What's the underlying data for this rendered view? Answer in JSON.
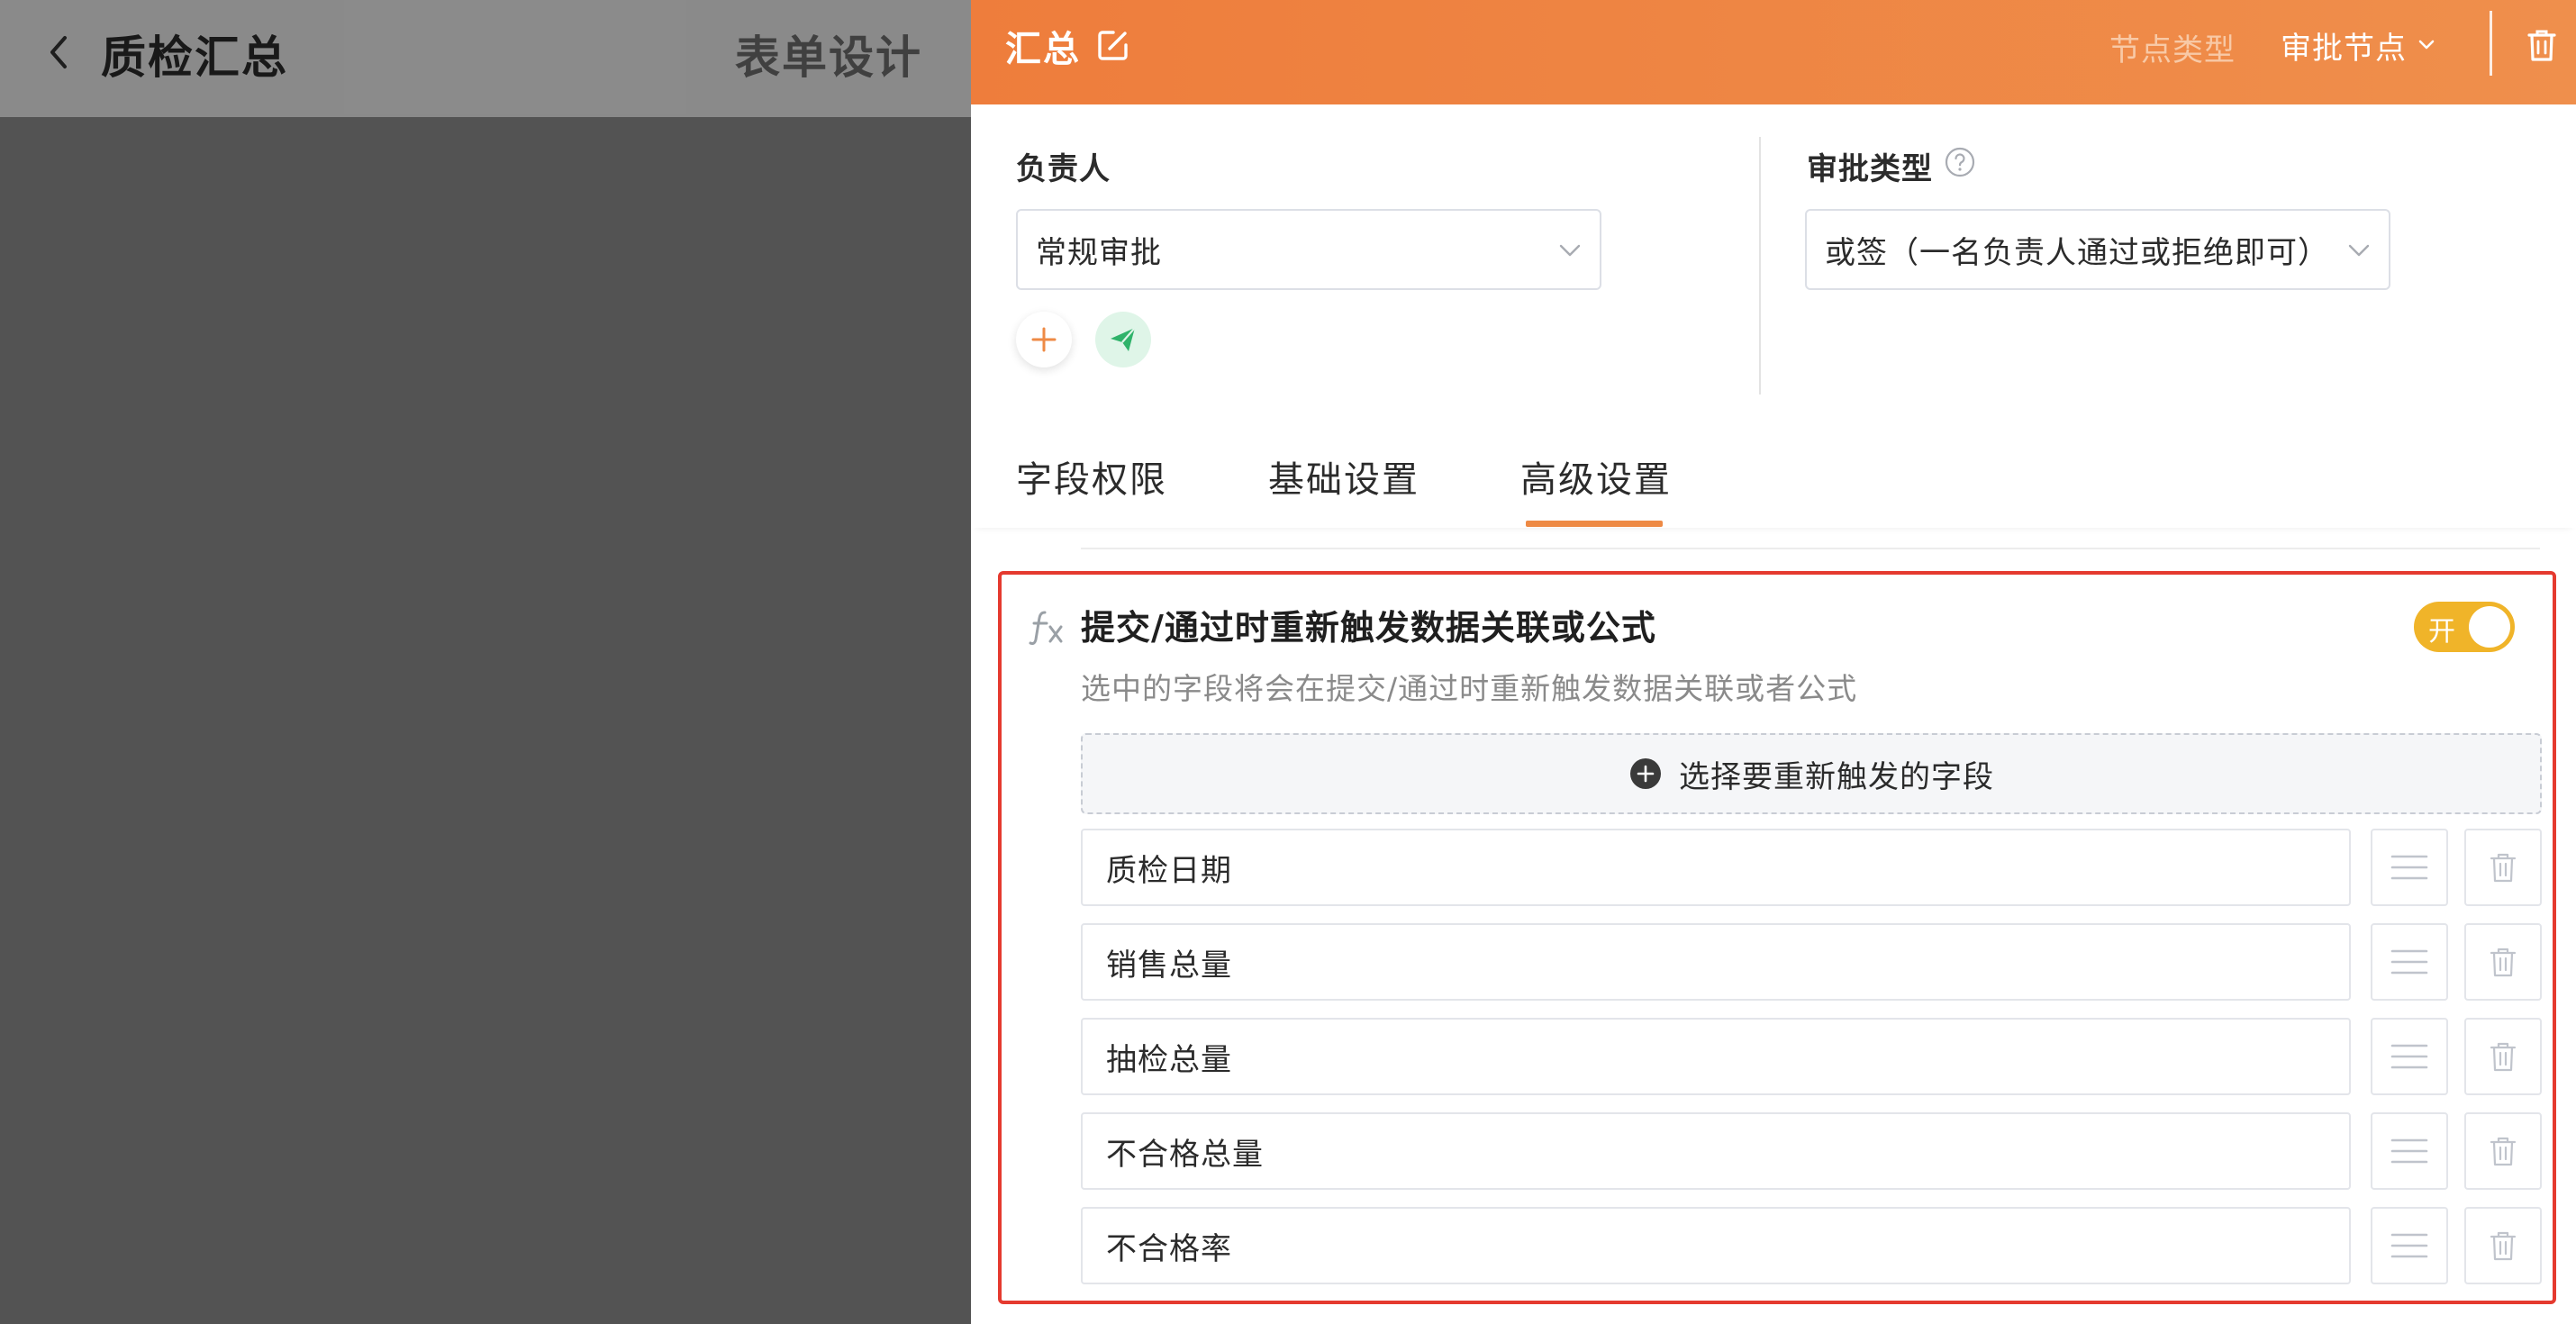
{
  "background_page": {
    "title": "质检汇总",
    "tab_label": "表单设计"
  },
  "drawer": {
    "title": "汇总",
    "node_type_label": "节点类型",
    "node_type_value": "审批节点",
    "owner_label": "负责人",
    "owner_select_value": "常规审批",
    "approval_type_label": "审批类型",
    "approval_type_value": "或签（一名负责人通过或拒绝即可）",
    "tabs": [
      {
        "label": "字段权限",
        "active": false
      },
      {
        "label": "基础设置",
        "active": false
      },
      {
        "label": "高级设置",
        "active": true
      }
    ],
    "retrigger_section": {
      "title": "提交/通过时重新触发数据关联或公式",
      "toggle_label": "开",
      "toggle_on": true,
      "description": "选中的字段将会在提交/通过时重新触发数据关联或者公式",
      "pick_button_label": "选择要重新触发的字段",
      "fields": [
        {
          "name": "质检日期"
        },
        {
          "name": "销售总量"
        },
        {
          "name": "抽检总量"
        },
        {
          "name": "不合格总量"
        },
        {
          "name": "不合格率"
        }
      ]
    }
  },
  "colors": {
    "header_accent": "#ee7d3c",
    "tab_active": "#ee8a45",
    "toggle_on": "#f0b429",
    "highlight_border": "#e53a2f"
  }
}
